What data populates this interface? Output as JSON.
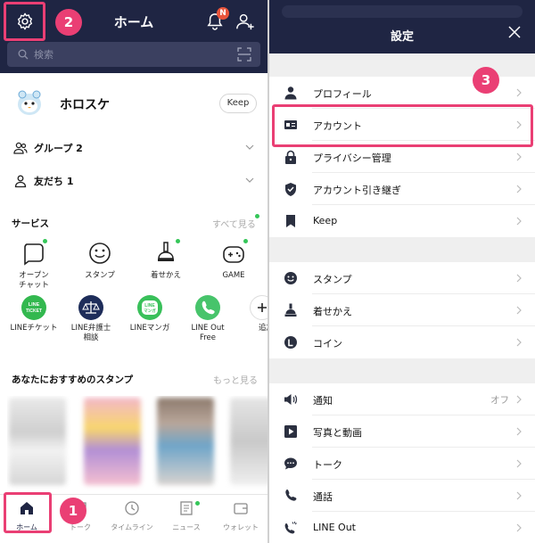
{
  "left": {
    "header": {
      "title": "ホーム",
      "notification_badge": "N",
      "search_placeholder": "検索"
    },
    "profile": {
      "name": "ホロスケ",
      "keep_label": "Keep"
    },
    "groups_label": "グループ 2",
    "friends_label": "友だち 1",
    "services": {
      "title": "サービス",
      "see_all": "すべて見る",
      "items": [
        {
          "label": "オープン\nチャット"
        },
        {
          "label": "スタンプ"
        },
        {
          "label": "着せかえ"
        },
        {
          "label": "GAME"
        },
        {
          "label": "LINEチケット",
          "icon_text": "LINE\nTICKET"
        },
        {
          "label": "LINE弁護士\n相談"
        },
        {
          "label": "LINEマンガ",
          "icon_text": "LINE\nマンガ"
        },
        {
          "label": "LINE Out\nFree"
        },
        {
          "label": "追加"
        }
      ]
    },
    "stickers": {
      "title": "あなたにおすすめのスタンプ",
      "more": "もっと見る"
    },
    "tabs": [
      {
        "label": "ホーム"
      },
      {
        "label": "トーク"
      },
      {
        "label": "タイムライン"
      },
      {
        "label": "ニュース"
      },
      {
        "label": "ウォレット"
      }
    ]
  },
  "right": {
    "title": "設定",
    "groups": [
      [
        {
          "label": "プロフィール",
          "icon": "person-icon"
        },
        {
          "label": "アカウント",
          "icon": "id-card-icon"
        },
        {
          "label": "プライバシー管理",
          "icon": "lock-icon"
        },
        {
          "label": "アカウント引き継ぎ",
          "icon": "shield-icon"
        },
        {
          "label": "Keep",
          "icon": "bookmark-icon"
        }
      ],
      [
        {
          "label": "スタンプ",
          "icon": "smiley-icon"
        },
        {
          "label": "着せかえ",
          "icon": "brush-icon"
        },
        {
          "label": "コイン",
          "icon": "coin-icon"
        }
      ],
      [
        {
          "label": "通知",
          "icon": "speaker-icon",
          "value": "オフ"
        },
        {
          "label": "写真と動画",
          "icon": "play-icon"
        },
        {
          "label": "トーク",
          "icon": "chat-icon"
        },
        {
          "label": "通話",
          "icon": "phone-icon"
        },
        {
          "label": "LINE Out",
          "icon": "line-out-icon"
        }
      ]
    ]
  },
  "annotations": [
    "1",
    "2",
    "3"
  ],
  "colors": {
    "header": "#1f2543",
    "accent": "#ea3f74",
    "green": "#35c659"
  }
}
